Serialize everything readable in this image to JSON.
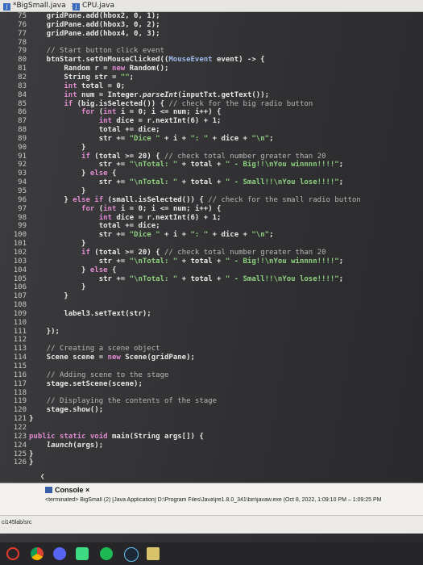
{
  "tabs": [
    {
      "label": "*BigSmall.java",
      "active": true,
      "close": "×"
    },
    {
      "label": "CPU.java",
      "active": false
    }
  ],
  "editor": {
    "lines": [
      {
        "n": "75",
        "html": "<span class='indent'>    </span>gridPane.add(hbox2, <span class='num'>0</span>, <span class='num'>1</span>);"
      },
      {
        "n": "76",
        "html": "    gridPane.add(hbox3, 0, 2);"
      },
      {
        "n": "77",
        "html": "    gridPane.add(hbox4, 0, 3);"
      },
      {
        "n": "78",
        "html": ""
      },
      {
        "n": "79",
        "html": "    // Start button click event"
      },
      {
        "n": "80",
        "html": "    btnStart.setOnMouseClicked((MouseEvent event) -> {"
      },
      {
        "n": "81",
        "html": "        Random r = new Random();"
      },
      {
        "n": "82",
        "html": "        String str = \"\";"
      },
      {
        "n": "83",
        "html": "        int total = 0;"
      },
      {
        "n": "84",
        "html": "        int num = Integer.parseInt(inputTxt.getText());"
      },
      {
        "n": "85",
        "html": "        if (big.isSelected()) { // check for the big radio button"
      },
      {
        "n": "86",
        "html": "            for (int i = 0; i <= num; i++) {"
      },
      {
        "n": "87",
        "html": "                int dice = r.nextInt(6) + 1;"
      },
      {
        "n": "88",
        "html": "                total += dice;"
      },
      {
        "n": "89",
        "html": "                str += \"Dice \" + i + \": \" + dice + \"\\n\";"
      },
      {
        "n": "90",
        "html": "            }"
      },
      {
        "n": "91",
        "html": "            if (total >= 20) { // check total number greater than 20"
      },
      {
        "n": "92",
        "html": "                str += \"\\nTotal: \" + total + \" - Big!!\\nYou winnnn!!!!\";"
      },
      {
        "n": "93",
        "html": "            } else {"
      },
      {
        "n": "94",
        "html": "                str += \"\\nTotal: \" + total + \" - Small!!\\nYou lose!!!!\";"
      },
      {
        "n": "95",
        "html": "            }"
      },
      {
        "n": "96",
        "html": "        } else if (small.isSelected()) { // check for the small radio button"
      },
      {
        "n": "97",
        "html": "            for (int i = 0; i <= num; i++) {"
      },
      {
        "n": "98",
        "html": "                int dice = r.nextInt(6) + 1;"
      },
      {
        "n": "99",
        "html": "                total += dice;"
      },
      {
        "n": "100",
        "html": "                str += \"Dice \" + i + \": \" + dice + \"\\n\";"
      },
      {
        "n": "101",
        "html": "            }"
      },
      {
        "n": "102",
        "html": "            if (total >= 20) { // check total number greater than 20"
      },
      {
        "n": "103",
        "html": "                str += \"\\nTotal: \" + total + \" - Big!!\\nYou winnnn!!!!\";"
      },
      {
        "n": "104",
        "html": "            } else {"
      },
      {
        "n": "105",
        "html": "                str += \"\\nTotal: \" + total + \" - Small!!\\nYou lose!!!!\";"
      },
      {
        "n": "106",
        "html": "            }"
      },
      {
        "n": "107",
        "html": "        }"
      },
      {
        "n": "108",
        "html": ""
      },
      {
        "n": "109",
        "html": "        label3.setText(str);"
      },
      {
        "n": "110",
        "html": ""
      },
      {
        "n": "111",
        "html": "    });"
      },
      {
        "n": "112",
        "html": ""
      },
      {
        "n": "113",
        "html": "    // Creating a scene object"
      },
      {
        "n": "114",
        "html": "    Scene scene = new Scene(gridPane);"
      },
      {
        "n": "115",
        "html": ""
      },
      {
        "n": "116",
        "html": "    // Adding scene to the stage"
      },
      {
        "n": "117",
        "html": "    stage.setScene(scene);"
      },
      {
        "n": "118",
        "html": ""
      },
      {
        "n": "119",
        "html": "    // Displaying the contents of the stage"
      },
      {
        "n": "120",
        "html": "    stage.show();"
      },
      {
        "n": "121",
        "html": "}"
      },
      {
        "n": "122",
        "html": ""
      },
      {
        "n": "123",
        "html": "public static void main(String args[]) {"
      },
      {
        "n": "124",
        "html": "    launch(args);"
      },
      {
        "n": "125",
        "html": "}"
      },
      {
        "n": "126",
        "html": "}"
      }
    ]
  },
  "console": {
    "tab_label": "Console",
    "close": "×",
    "status": "<terminated> BigSmall (2) [Java Application] D:\\Program Files\\Java\\jre1.8.0_341\\bin\\javaw.exe (Oct 8, 2022, 1:09:10 PM – 1:09:25 PM"
  },
  "pathbar": {
    "text": "ci145lab/src"
  },
  "colors": {
    "background": "#333335",
    "keyword": "#e08bd0",
    "string": "#8fd080",
    "comment": "#b8b8b8"
  },
  "taskbar_icons": [
    "windows-icon",
    "chrome-icon",
    "discord-icon",
    "android-studio-icon",
    "spotify-icon",
    "steam-icon",
    "files-icon"
  ]
}
